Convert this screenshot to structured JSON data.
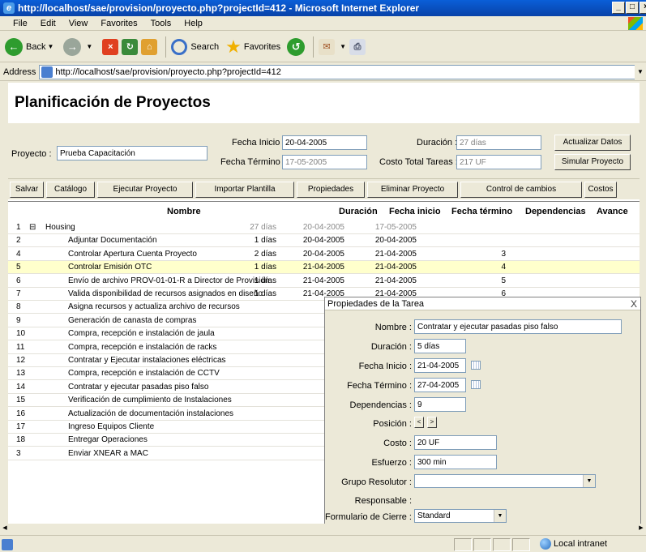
{
  "window": {
    "title": "http://localhost/sae/provision/proyecto.php?projectId=412 - Microsoft Internet Explorer"
  },
  "menu": [
    "File",
    "Edit",
    "View",
    "Favorites",
    "Tools",
    "Help"
  ],
  "toolbar": {
    "back": "Back",
    "search": "Search",
    "favorites": "Favorites"
  },
  "address": {
    "label": "Address",
    "url": "http://localhost/sae/provision/proyecto.php?projectId=412"
  },
  "page": {
    "title": "Planificación de Proyectos",
    "proyecto_label": "Proyecto :",
    "proyecto_value": "Prueba Capacitación",
    "fecha_inicio_label": "Fecha Inicio :",
    "fecha_inicio_value": "20-04-2005",
    "fecha_termino_label": "Fecha Término :",
    "fecha_termino_value": "17-05-2005",
    "duracion_label": "Duración :",
    "duracion_value": "27 días",
    "costo_label": "Costo Total Tareas :",
    "costo_value": "217 UF",
    "actualizar_btn": "Actualizar Datos",
    "simular_btn": "Simular Proyecto"
  },
  "actions": [
    "Salvar",
    "Catálogo",
    "Ejecutar Proyecto",
    "Importar Plantilla",
    "Propiedades",
    "Eliminar Proyecto",
    "Control de cambios",
    "Costos"
  ],
  "grid": {
    "headers": {
      "nombre": "Nombre",
      "duracion": "Duración",
      "inicio": "Fecha inicio",
      "termino": "Fecha término",
      "dependencias": "Dependencias",
      "avance": "Avance"
    },
    "rows": [
      {
        "num": "1",
        "expander": "⊟",
        "name": "Housing",
        "dur": "27 días",
        "ini": "20-04-2005",
        "fin": "17-05-2005",
        "dep": ""
      },
      {
        "num": "2",
        "name": "Adjuntar Documentación",
        "dur": "1 días",
        "ini": "20-04-2005",
        "fin": "20-04-2005",
        "dep": ""
      },
      {
        "num": "4",
        "name": "Controlar Apertura Cuenta Proyecto",
        "dur": "2 días",
        "ini": "20-04-2005",
        "fin": "21-04-2005",
        "dep": "3"
      },
      {
        "num": "5",
        "name": "Controlar Emisión OTC",
        "dur": "1 días",
        "ini": "21-04-2005",
        "fin": "21-04-2005",
        "dep": "4"
      },
      {
        "num": "6",
        "name": "Envío de archivo PROV-01-01-R a Director de Provisión",
        "dur": "1 días",
        "ini": "21-04-2005",
        "fin": "21-04-2005",
        "dep": "5"
      },
      {
        "num": "7",
        "name": "Valida disponibilidad de recursos asignados en diseño",
        "dur": "1 días",
        "ini": "21-04-2005",
        "fin": "21-04-2005",
        "dep": "6"
      },
      {
        "num": "8",
        "name": "Asigna recursos y actualiza archivo de recursos"
      },
      {
        "num": "9",
        "name": "Generación de canasta de compras"
      },
      {
        "num": "10",
        "name": "Compra, recepción e instalación de jaula"
      },
      {
        "num": "11",
        "name": "Compra, recepción e instalación de racks"
      },
      {
        "num": "12",
        "name": "Contratar y Ejecutar instalaciones eléctricas"
      },
      {
        "num": "13",
        "name": "Compra, recepción e instalación de CCTV"
      },
      {
        "num": "14",
        "name": "Contratar y ejecutar pasadas piso falso"
      },
      {
        "num": "15",
        "name": "Verificación de cumplimiento de Instalaciones"
      },
      {
        "num": "16",
        "name": "Actualización de documentación instalaciones"
      },
      {
        "num": "17",
        "name": "Ingreso Equipos Cliente"
      },
      {
        "num": "18",
        "name": "Entregar Operaciones"
      },
      {
        "num": "3",
        "name": "Enviar XNEAR a MAC"
      }
    ]
  },
  "dialog": {
    "title": "Propiedades de la Tarea",
    "close": "X",
    "nombre_label": "Nombre :",
    "nombre_value": "Contratar y ejecutar pasadas piso falso",
    "duracion_label": "Duración :",
    "duracion_value": "5 días",
    "inicio_label": "Fecha Inicio :",
    "inicio_value": "21-04-2005",
    "termino_label": "Fecha Término :",
    "termino_value": "27-04-2005",
    "dependencias_label": "Dependencias :",
    "dependencias_value": "9",
    "posicion_label": "Posición :",
    "pos_left": "<",
    "pos_right": ">",
    "costo_label": "Costo :",
    "costo_value": "20 UF",
    "esfuerzo_label": "Esfuerzo :",
    "esfuerzo_value": "300 min",
    "grupo_label": "Grupo Resolutor :",
    "grupo_value": "",
    "responsable_label": "Responsable :",
    "formulario_label": "Formulario de Cierre :",
    "formulario_value": "Standard"
  },
  "status": {
    "zone": "Local intranet"
  }
}
